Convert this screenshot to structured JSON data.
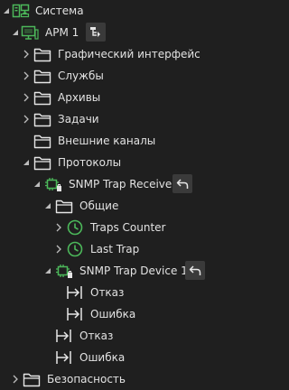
{
  "tree": {
    "root": {
      "label": "Система",
      "icon": "system-icon"
    },
    "arm": {
      "label": "АРМ 1",
      "icon": "workstation-icon",
      "action_icon": "tree-structure-icon"
    },
    "gui": {
      "label": "Графический интерфейс",
      "icon": "folder-icon"
    },
    "services": {
      "label": "Службы",
      "icon": "folder-icon"
    },
    "archives": {
      "label": "Архивы",
      "icon": "folder-icon"
    },
    "tasks": {
      "label": "Задачи",
      "icon": "folder-icon"
    },
    "external_channels": {
      "label": "Внешние каналы",
      "icon": "folder-icon"
    },
    "protocols": {
      "label": "Протоколы",
      "icon": "folder-icon"
    },
    "snmp_receiver": {
      "label": "SNMP Trap Receiver",
      "icon": "snmp-device-icon",
      "action_icon": "undo-arrow-icon"
    },
    "general": {
      "label": "Общие",
      "icon": "folder-icon"
    },
    "traps_counter": {
      "label": "Traps Counter",
      "icon": "clock-icon"
    },
    "last_trap": {
      "label": "Last Trap",
      "icon": "clock-icon"
    },
    "snmp_device": {
      "label": "SNMP Trap Device 1",
      "icon": "snmp-device-icon",
      "action_icon": "undo-arrow-icon"
    },
    "device_fail": {
      "label": "Отказ",
      "icon": "signal-icon"
    },
    "device_error": {
      "label": "Ошибка",
      "icon": "signal-icon"
    },
    "receiver_fail": {
      "label": "Отказ",
      "icon": "signal-icon"
    },
    "receiver_error": {
      "label": "Ошибка",
      "icon": "signal-icon"
    },
    "security": {
      "label": "Безопасность",
      "icon": "folder-icon"
    }
  },
  "colors": {
    "background": "#1f1f1f",
    "icon_green": "#4cb85a",
    "text": "#e2e2e2",
    "arrow": "#bdbdbd",
    "action_bg": "#3a3a3a"
  }
}
